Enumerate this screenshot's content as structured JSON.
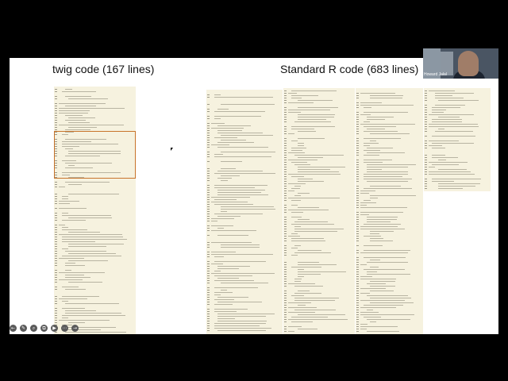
{
  "slide": {
    "left_heading": "twig code (167 lines)",
    "right_heading": "Standard R code (683 lines)"
  },
  "video": {
    "participant_name": "Howard Jalal"
  },
  "toolbar": [
    {
      "name": "previous-arrow-icon",
      "glyph": "←"
    },
    {
      "name": "pen-icon",
      "glyph": "✎"
    },
    {
      "name": "zoom-icon",
      "glyph": "⌕"
    },
    {
      "name": "subtitles-icon",
      "glyph": "⧉"
    },
    {
      "name": "video-icon",
      "glyph": "▶"
    },
    {
      "name": "more-options-icon",
      "glyph": "⋯"
    },
    {
      "name": "next-arrow-icon",
      "glyph": "→"
    }
  ]
}
